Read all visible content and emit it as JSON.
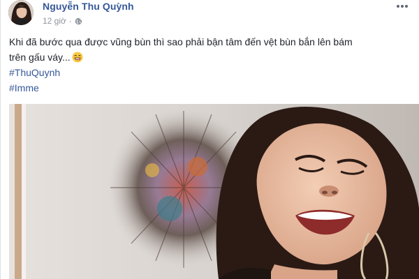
{
  "post": {
    "author": "Nguyễn Thu Quỳnh",
    "time": "12 giờ",
    "separator": "·",
    "audience_icon": "globe-icon",
    "more_icon": "more-options-icon",
    "caption_line1": "Khi đã bước qua được vũng bùn thì sao phải bận tâm đến vệt bùn bắn lên bám",
    "caption_line2": "trên gấu váy...",
    "caption_emoji": "grinning-face-icon",
    "hashtags": [
      "#ThuQuynh",
      "#Imme"
    ],
    "photo_description_icon": "photo-laughing-woman",
    "colors": {
      "name_link": "#365899",
      "text": "#1d2129",
      "meta": "#90949c",
      "background": "#e9ebee"
    }
  }
}
